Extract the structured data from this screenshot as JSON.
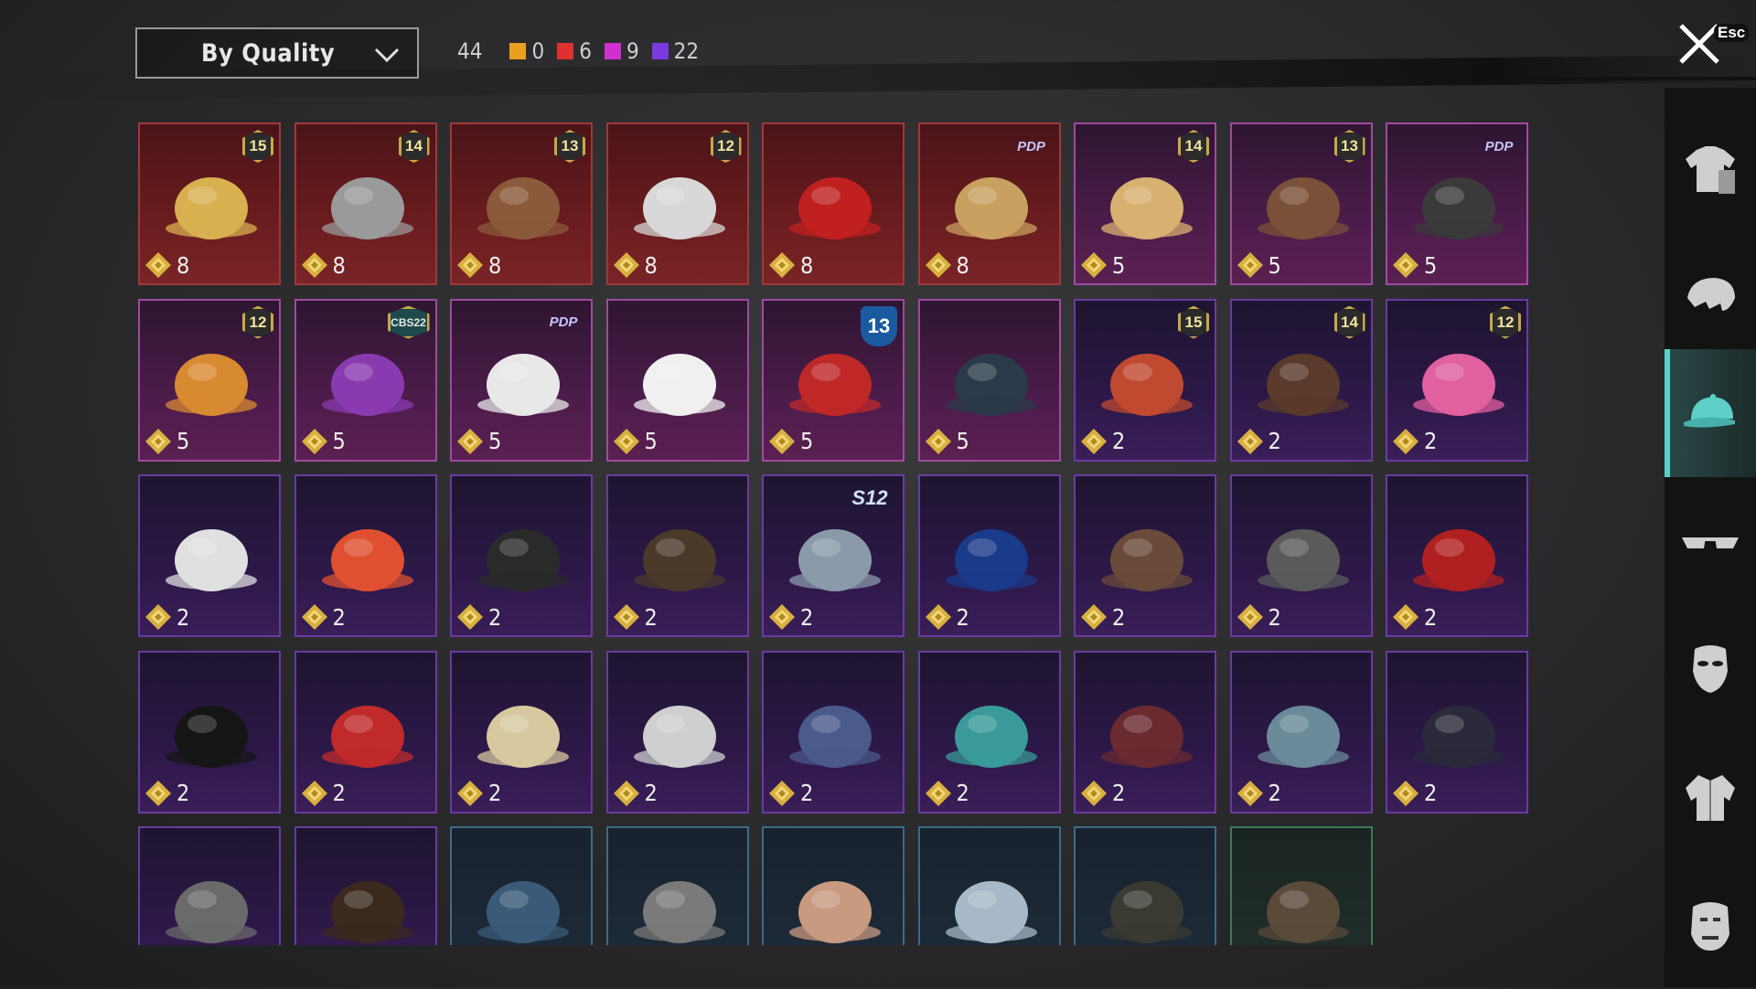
{
  "sort": {
    "label": "By Quality"
  },
  "counts": {
    "total": "44",
    "qualities": [
      {
        "color": "#e8a020",
        "count": "0"
      },
      {
        "color": "#e03030",
        "count": "6"
      },
      {
        "color": "#d030d0",
        "count": "9"
      },
      {
        "color": "#7a3ae0",
        "count": "22"
      }
    ]
  },
  "close": {
    "esc_label": "Esc"
  },
  "sidebar": {
    "tabs": [
      {
        "name": "outfit-tab",
        "icon": "shirt-icon",
        "active": false
      },
      {
        "name": "hair-tab",
        "icon": "hair-icon",
        "active": false
      },
      {
        "name": "hat-tab",
        "icon": "cap-icon",
        "active": true
      },
      {
        "name": "eyewear-tab",
        "icon": "glasses-icon",
        "active": false
      },
      {
        "name": "mask-tab",
        "icon": "mask-icon",
        "active": false
      },
      {
        "name": "top-tab",
        "icon": "jacket-icon",
        "active": false
      },
      {
        "name": "face-tab",
        "icon": "face-icon",
        "active": false
      }
    ]
  },
  "items": [
    {
      "quality": "red",
      "price": "8",
      "badge": "15",
      "badge_type": "hex",
      "icon": "blonde-hair-icon",
      "color": "#d8b050"
    },
    {
      "quality": "red",
      "price": "8",
      "badge": "14",
      "badge_type": "hex",
      "icon": "cat-mask-icon",
      "color": "#9a9a9a"
    },
    {
      "quality": "red",
      "price": "8",
      "badge": "13",
      "badge_type": "hex",
      "icon": "pirate-hat-icon",
      "color": "#8a5a3a"
    },
    {
      "quality": "red",
      "price": "8",
      "badge": "12",
      "badge_type": "hex",
      "icon": "white-hair-icon",
      "color": "#d8d8d8"
    },
    {
      "quality": "red",
      "price": "8",
      "badge": "",
      "badge_type": "",
      "icon": "red-helmet-icon",
      "color": "#c02020"
    },
    {
      "quality": "red",
      "price": "8",
      "badge": "PDP",
      "badge_type": "tag",
      "icon": "samurai-helmet-icon",
      "color": "#c8a060"
    },
    {
      "quality": "pink",
      "price": "5",
      "badge": "14",
      "badge_type": "hex",
      "icon": "flower-hair-icon",
      "color": "#d8b070"
    },
    {
      "quality": "pink",
      "price": "5",
      "badge": "13",
      "badge_type": "hex",
      "icon": "aviator-cap-icon",
      "color": "#7a5038"
    },
    {
      "quality": "pink",
      "price": "5",
      "badge": "PDP",
      "badge_type": "tag",
      "icon": "baseball-cap-icon",
      "color": "#3a3a3a"
    },
    {
      "quality": "pink",
      "price": "5",
      "badge": "12",
      "badge_type": "hex",
      "icon": "orange-hair-icon",
      "color": "#d88a30"
    },
    {
      "quality": "pink",
      "price": "5",
      "badge": "CBS22",
      "badge_type": "hex-teal",
      "icon": "purple-hair-icon",
      "color": "#8a3ab0"
    },
    {
      "quality": "pink",
      "price": "5",
      "badge": "PDP",
      "badge_type": "tag",
      "icon": "panda-mask-icon",
      "color": "#e8e8e8"
    },
    {
      "quality": "pink",
      "price": "5",
      "badge": "",
      "badge_type": "",
      "icon": "lion-mask-icon",
      "color": "#f0f0f0"
    },
    {
      "quality": "pink",
      "price": "5",
      "badge": "13",
      "badge_type": "shield",
      "icon": "demon-helmet-icon",
      "color": "#c02828"
    },
    {
      "quality": "pink",
      "price": "5",
      "badge": "",
      "badge_type": "",
      "icon": "goggle-helmet-icon",
      "color": "#2a3a4a"
    },
    {
      "quality": "purple",
      "price": "2",
      "badge": "15",
      "badge_type": "hex",
      "icon": "pumpkin-hat-icon",
      "color": "#c04a30"
    },
    {
      "quality": "purple",
      "price": "2",
      "badge": "14",
      "badge_type": "hex",
      "icon": "cat-ear-cap-icon",
      "color": "#5a3a2a"
    },
    {
      "quality": "purple",
      "price": "2",
      "badge": "12",
      "badge_type": "hex",
      "icon": "bunny-helmet-icon",
      "color": "#e060a0"
    },
    {
      "quality": "purple",
      "price": "2",
      "badge": "",
      "badge_type": "",
      "icon": "sport-cap-icon",
      "color": "#e0e0e0"
    },
    {
      "quality": "purple",
      "price": "2",
      "badge": "",
      "badge_type": "",
      "icon": "devil-horns-icon",
      "color": "#e05030"
    },
    {
      "quality": "purple",
      "price": "2",
      "badge": "",
      "badge_type": "",
      "icon": "mesh-cap-icon",
      "color": "#2a2a2a"
    },
    {
      "quality": "purple",
      "price": "2",
      "badge": "",
      "badge_type": "",
      "icon": "steampunk-hat-icon",
      "color": "#4a3a2a"
    },
    {
      "quality": "purple",
      "price": "2",
      "badge": "S12",
      "badge_type": "s12",
      "icon": "astronaut-helmet-icon",
      "color": "#8a9aaa"
    },
    {
      "quality": "purple",
      "price": "2",
      "badge": "",
      "badge_type": "",
      "icon": "blue-beanie-icon",
      "color": "#1a3a8a"
    },
    {
      "quality": "purple",
      "price": "2",
      "badge": "",
      "badge_type": "",
      "icon": "cowboy-hat-icon",
      "color": "#6a4a38"
    },
    {
      "quality": "purple",
      "price": "2",
      "badge": "",
      "badge_type": "",
      "icon": "wrestler-mask-icon",
      "color": "#5a5a5a"
    },
    {
      "quality": "purple",
      "price": "2",
      "badge": "",
      "badge_type": "",
      "icon": "red-beret-icon",
      "color": "#b02020"
    },
    {
      "quality": "purple",
      "price": "2",
      "badge": "",
      "badge_type": "",
      "icon": "black-bowler-hat-icon",
      "color": "#151515"
    },
    {
      "quality": "purple",
      "price": "2",
      "badge": "",
      "badge_type": "",
      "icon": "red-fedora-icon",
      "color": "#c02a2a"
    },
    {
      "quality": "purple",
      "price": "2",
      "badge": "",
      "badge_type": "",
      "icon": "cupcake-hat-icon",
      "color": "#d8c8a0"
    },
    {
      "quality": "purple",
      "price": "2",
      "badge": "",
      "badge_type": "",
      "icon": "headlamp-icon",
      "color": "#cfcfcf"
    },
    {
      "quality": "purple",
      "price": "2",
      "badge": "",
      "badge_type": "",
      "icon": "sailor-cap-icon",
      "color": "#4a5a8a"
    },
    {
      "quality": "purple",
      "price": "2",
      "badge": "",
      "badge_type": "",
      "icon": "teal-cap-icon",
      "color": "#3a9a9a"
    },
    {
      "quality": "purple",
      "price": "2",
      "badge": "",
      "badge_type": "",
      "icon": "maroon-fedora-icon",
      "color": "#6a2a30"
    },
    {
      "quality": "purple",
      "price": "2",
      "badge": "",
      "badge_type": "",
      "icon": "bandana-icon",
      "color": "#6a8a9a"
    },
    {
      "quality": "purple",
      "price": "2",
      "badge": "",
      "badge_type": "",
      "icon": "bucket-hat-icon",
      "color": "#2a2a3a"
    },
    {
      "quality": "purple",
      "price": "",
      "badge": "",
      "badge_type": "",
      "icon": "aviator-helmet-icon",
      "color": "#6a6a6a"
    },
    {
      "quality": "purple",
      "price": "",
      "badge": "",
      "badge_type": "",
      "icon": "brown-hair-icon",
      "color": "#3a2a1e"
    },
    {
      "quality": "blue",
      "price": "",
      "badge": "",
      "badge_type": "",
      "icon": "blue-beret-icon",
      "color": "#3a5a78"
    },
    {
      "quality": "blue",
      "price": "",
      "badge": "",
      "badge_type": "",
      "icon": "grey-beret-icon",
      "color": "#7a7a7a"
    },
    {
      "quality": "blue",
      "price": "",
      "badge": "",
      "badge_type": "",
      "icon": "red-trucker-cap-icon",
      "color": "#c89a80"
    },
    {
      "quality": "blue",
      "price": "",
      "badge": "",
      "badge_type": "",
      "icon": "blue-trucker-cap-icon",
      "color": "#a8b8c8"
    },
    {
      "quality": "blue",
      "price": "",
      "badge": "",
      "badge_type": "",
      "icon": "camo-headset-cap-icon",
      "color": "#3a3a32"
    },
    {
      "quality": "green",
      "price": "",
      "badge": "",
      "badge_type": "",
      "icon": "military-cap-icon",
      "color": "#5a4a3a"
    }
  ]
}
